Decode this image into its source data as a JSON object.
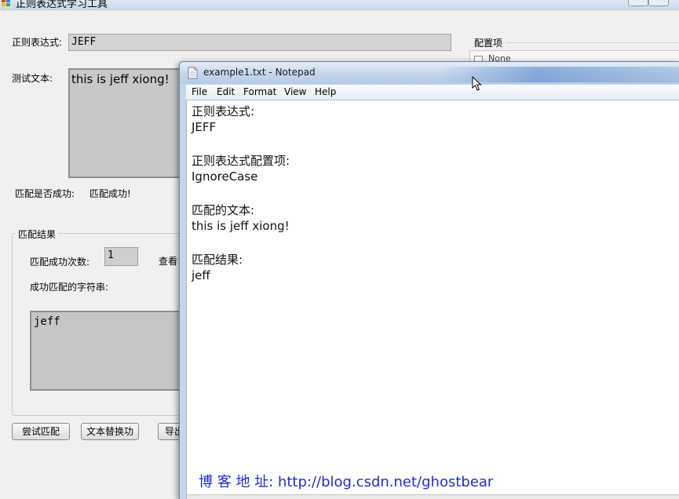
{
  "app": {
    "title": "正则表达式学习工具",
    "regex_label": "正则表达式:",
    "regex_value": "JEFF",
    "test_text_label": "测试文本:",
    "test_text_value": "this is jeff xiong!",
    "match_status_label": "匹配是否成功:",
    "match_status_value": "匹配成功!",
    "result_group_title": "匹配结果",
    "match_count_label": "匹配成功次数:",
    "match_count_value": "1",
    "view_label_partial": "查看",
    "matched_strings_label": "成功匹配的字符串:",
    "matched_output": "jeff",
    "buttons": {
      "try_match": "尝试匹配",
      "replace_text": "文本替换功",
      "export": "导出"
    },
    "config_title": "配置项",
    "config_items": [
      "None"
    ]
  },
  "notepad": {
    "title": "example1.txt - Notepad",
    "menu": [
      "File",
      "Edit",
      "Format",
      "View",
      "Help"
    ],
    "lines": [
      "正则表达式:",
      "JEFF",
      "",
      "正则表达式配置项:",
      "IgnoreCase",
      "",
      "匹配的文本:",
      "this is jeff xiong!",
      "",
      "匹配结果:",
      "jeff"
    ],
    "blog": "博 客 地 址: http://blog.csdn.net/ghostbear"
  },
  "colors": {
    "notepad_blog_text": "#1c2fd0",
    "readonly_field": "#c8c8c8"
  }
}
